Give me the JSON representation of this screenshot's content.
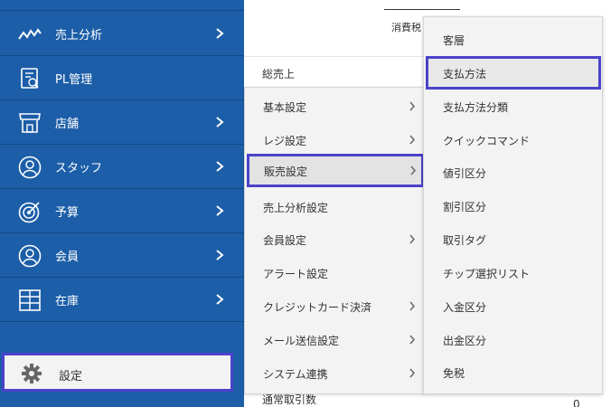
{
  "sidebar": {
    "items": [
      {
        "label": "売上分析",
        "icon": "line-chart-icon",
        "has_submenu": true
      },
      {
        "label": "PL管理",
        "icon": "pl-report-icon",
        "has_submenu": false
      },
      {
        "label": "店舗",
        "icon": "store-icon",
        "has_submenu": true
      },
      {
        "label": "スタッフ",
        "icon": "staff-icon",
        "has_submenu": true
      },
      {
        "label": "予算",
        "icon": "target-icon",
        "has_submenu": true
      },
      {
        "label": "会員",
        "icon": "member-icon",
        "has_submenu": true
      },
      {
        "label": "在庫",
        "icon": "inventory-icon",
        "has_submenu": true
      }
    ],
    "settings": {
      "label": "設定",
      "icon": "gear-icon"
    }
  },
  "main": {
    "tax_label": "消費税",
    "total_label": "総売上",
    "behind_label": "通常取引数",
    "behind_value": "0"
  },
  "settings_menu": {
    "items": [
      {
        "label": "基本設定",
        "has_submenu": true
      },
      {
        "label": "レジ設定",
        "has_submenu": true
      },
      {
        "label": "販売設定",
        "has_submenu": true,
        "active": true
      },
      {
        "label": "売上分析設定",
        "has_submenu": false
      },
      {
        "label": "会員設定",
        "has_submenu": true
      },
      {
        "label": "アラート設定",
        "has_submenu": false
      },
      {
        "label": "クレジットカード決済",
        "has_submenu": true
      },
      {
        "label": "メール送信設定",
        "has_submenu": true
      },
      {
        "label": "システム連携",
        "has_submenu": true
      }
    ]
  },
  "sales_menu": {
    "items": [
      {
        "label": "客層"
      },
      {
        "label": "支払方法",
        "active": true
      },
      {
        "label": "支払方法分類"
      },
      {
        "label": "クイックコマンド"
      },
      {
        "label": "値引区分"
      },
      {
        "label": "割引区分"
      },
      {
        "label": "取引タグ"
      },
      {
        "label": "チップ選択リスト"
      },
      {
        "label": "入金区分"
      },
      {
        "label": "出金区分"
      },
      {
        "label": "免税"
      }
    ]
  },
  "colors": {
    "sidebar_bg": "#1c5ea8",
    "highlight_border": "#4a42c9",
    "menu_bg": "#f3f3f3"
  }
}
